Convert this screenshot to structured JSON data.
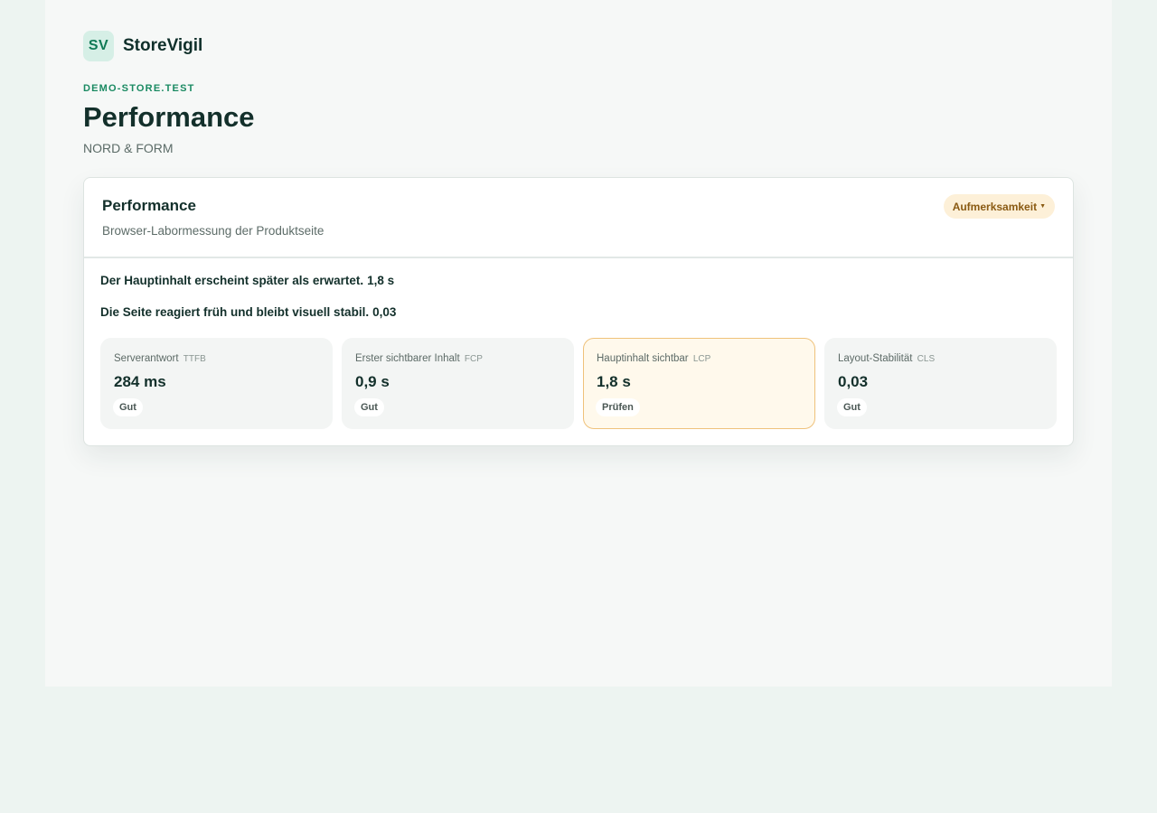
{
  "brand": {
    "logo": "SV",
    "name": "StoreVigil"
  },
  "header": {
    "store": "DEMO-STORE.TEST",
    "title": "Performance",
    "subtitle": "NORD & FORM"
  },
  "card": {
    "title": "Performance",
    "subtitle": "Browser-Labormessung der Produktseite",
    "status": "Aufmerksamkeit",
    "status_icon": "caret-down-icon",
    "colors": {
      "status_bg": "#fdf0d8",
      "status_text": "#8a5a12",
      "warn_border": "#efc27b"
    }
  },
  "findings": [
    {
      "text": "Der Hauptinhalt erscheint später als erwartet.",
      "value": "1,8 s"
    },
    {
      "text": "Die Seite reagiert früh und bleibt visuell stabil.",
      "value": "0,03"
    }
  ],
  "metrics": [
    {
      "label": "Serverantwort",
      "abbr": "TTFB",
      "value": "284 ms",
      "rating": "Gut"
    },
    {
      "label": "Erster sichtbarer Inhalt",
      "abbr": "FCP",
      "value": "0,9 s",
      "rating": "Gut"
    },
    {
      "label": "Hauptinhalt sichtbar",
      "abbr": "LCP",
      "value": "1,8 s",
      "rating": "Prüfen"
    },
    {
      "label": "Layout-Stabilität",
      "abbr": "CLS",
      "value": "0,03",
      "rating": "Gut"
    }
  ]
}
